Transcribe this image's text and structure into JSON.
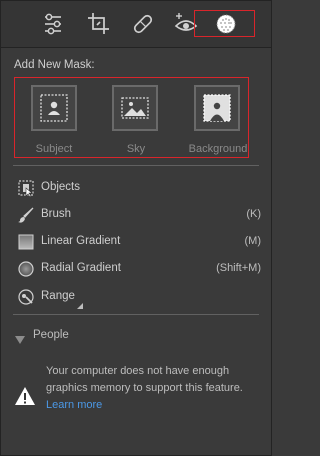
{
  "toolbar": {
    "tools": [
      {
        "name": "edit-sliders-icon"
      },
      {
        "name": "crop-icon"
      },
      {
        "name": "healing-bandage-icon"
      },
      {
        "name": "red-eye-icon"
      },
      {
        "name": "masking-icon",
        "active": true
      }
    ]
  },
  "mask_section": {
    "title": "Add New Mask:",
    "buttons": [
      {
        "label": "Subject",
        "icon": "person-icon"
      },
      {
        "label": "Sky",
        "icon": "sky-landscape-icon"
      },
      {
        "label": "Background",
        "icon": "background-person-icon"
      }
    ]
  },
  "tools_list": [
    {
      "label": "Objects",
      "icon": "objects-select-icon",
      "shortcut": ""
    },
    {
      "label": "Brush",
      "icon": "brush-icon",
      "shortcut": "(K)"
    },
    {
      "label": "Linear Gradient",
      "icon": "linear-gradient-icon",
      "shortcut": "(M)"
    },
    {
      "label": "Radial Gradient",
      "icon": "radial-gradient-icon",
      "shortcut": "(Shift+M)"
    },
    {
      "label": "Range",
      "icon": "range-icon",
      "shortcut": ""
    }
  ],
  "people": {
    "title": "People",
    "message": "Your computer does not have enough graphics memory to support this feature.",
    "link": "Learn more"
  },
  "colors": {
    "panel_bg": "#3a3a3a",
    "highlight_red": "#d9252b",
    "link_blue": "#4b98e6"
  }
}
